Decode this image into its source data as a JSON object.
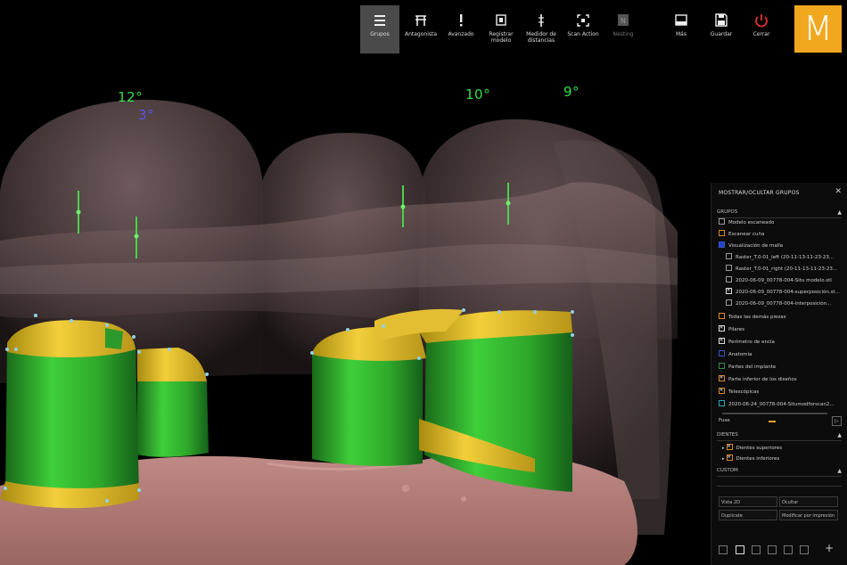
{
  "toolbar": {
    "items": [
      {
        "label": "Grupos",
        "icon": "menu-icon"
      },
      {
        "label": "Antagonista",
        "icon": "antagonist-icon"
      },
      {
        "label": "Avanzado",
        "icon": "exclamation-icon"
      },
      {
        "label": "Registrar modelo",
        "icon": "register-model-icon"
      },
      {
        "label": "Medidor de distancias",
        "icon": "distance-meter-icon"
      },
      {
        "label": "Scan Action",
        "icon": "scan-action-icon"
      },
      {
        "label": "Nesting",
        "icon": "nesting-icon"
      },
      {
        "label": "Más",
        "icon": "more-icon"
      },
      {
        "label": "Guardar",
        "icon": "save-icon"
      },
      {
        "label": "Cerrar",
        "icon": "power-icon"
      }
    ],
    "logo_letter": "M",
    "accent": "#f1a81e"
  },
  "viewport": {
    "angles": [
      {
        "text": "12°",
        "color": "green"
      },
      {
        "text": "3°",
        "color": "blue"
      },
      {
        "text": "10°",
        "color": "green"
      },
      {
        "text": "9°",
        "color": "green"
      }
    ]
  },
  "panel": {
    "title": "MOSTRAR/OCULTAR GRUPOS",
    "close": "✕",
    "sections": {
      "grupos": "GRUPOS",
      "dientes": "DIENTES",
      "custom": "CUSTOM"
    },
    "items": [
      "Modelo escaneado",
      "Escanear cuña",
      "Visualización de malla",
      "Raster_T.0-01_left (20-11-13-11-23-23...",
      "Raster_T.0-01_right (20-11-13-11-23-23...",
      "2020-06-09_00778-004-Situ modelo.stl",
      "2020-06-09_00778-004-superposición.st...",
      "2020-06-09_00778-004-interposición...",
      "Todas las demás piezas",
      "Pilares",
      "Perímetro de encía",
      "Anatomía",
      "Partes del implante",
      "Parte inferior de los diseños",
      "Telescópicas",
      "2020-06-24_00778-004-Situmodforscan2..."
    ],
    "fuse_label": "Fuse",
    "teeth_items": [
      "Dientes superiores",
      "Dientes inferiores"
    ],
    "fields": [
      {
        "label": "Vista 2D",
        "value": "Ocultar"
      },
      {
        "label": "Duplicate",
        "value": "Modificar por impresión"
      }
    ]
  }
}
